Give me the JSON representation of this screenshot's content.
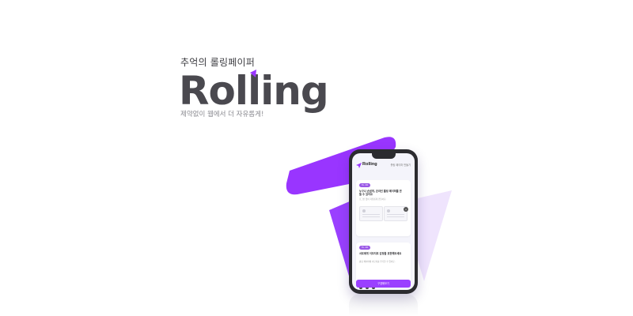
{
  "hero": {
    "tagline": "추억의 롤링페이퍼",
    "logo_text": "Rolling",
    "subline": "제약없이 웹에서 더 자유롭게!"
  },
  "phone": {
    "app_logo": "Rolling",
    "header_cta": "롤링 페이퍼 만들기",
    "cards": [
      {
        "badge": "To. 00",
        "title": "누구나 손쉽게, 온라인 롤링 페이퍼를 만들 수 있어요",
        "meta": "로그인 없이 자유롭게 만들어요."
      },
      {
        "badge": "To. 00",
        "title": "서로에게 이모지로 감정을 표현해보세요",
        "meta": "롤링 페이퍼에 이모지를 추가할 수 있어요."
      }
    ],
    "more_count": "+",
    "bottom_button": "구경해보기"
  },
  "colors": {
    "brand": "#9935ff",
    "brand_light": "#e9d8fd",
    "logo_dark": "#4a494f",
    "pill": "#9a58e6"
  },
  "icons": [
    "paper-plane-icon"
  ]
}
